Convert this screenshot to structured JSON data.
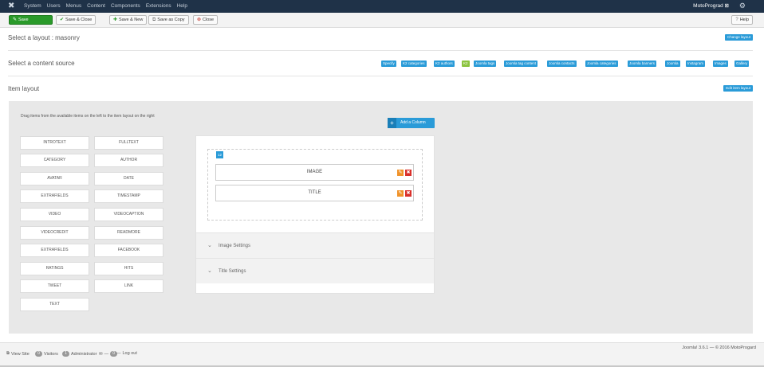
{
  "topbar": {
    "logo": "✖",
    "menu": [
      "System",
      "Users",
      "Menus",
      "Content",
      "Components",
      "Extensions",
      "Help"
    ],
    "user": "MotoPrograd ⊠",
    "gear": "⚙"
  },
  "toolbar": {
    "save": "Save",
    "save_close": "Save & Close",
    "save_new": "Save & New",
    "save_copy": "Save as Copy",
    "close": "Close",
    "help": "Help"
  },
  "sections": {
    "layout_label": "Select a layout : masonry",
    "layout_button": "Change layout",
    "source_label": "Select a content source",
    "sources": [
      "Specify",
      "K2 categories",
      "K2 authors",
      "K2",
      "Joomla tags",
      "Joomla tag content",
      "Joomla contacts",
      "Joomla categories",
      "Joomla banners",
      "Joomla",
      "Instagram",
      "Images",
      "Gallery"
    ],
    "item_layout_label": "Item layout",
    "item_layout_button": "Edit item layout"
  },
  "builder": {
    "hint": "Drag items from the available items on the left to the item layout on the right",
    "add_column": "Add a Column",
    "fields": [
      "INTROTEXT",
      "FULLTEXT",
      "CATEGORY",
      "AUTHOR",
      "AVATAR",
      "DATE",
      "EXTRAFIELDS",
      "TIMESTAMP",
      "VIDEO",
      "VIDEOCAPTION",
      "VIDEOCREDIT",
      "READMORE",
      "EXTRAFIELDS",
      "FACEBOOK",
      "RATINGS",
      "HITS",
      "TWEET",
      "LINK",
      "TEXT"
    ],
    "column_badge": "12",
    "items": [
      "IMAGE",
      "TITLE"
    ],
    "settings": [
      "Image Settings",
      "Title Settings"
    ]
  },
  "footer": {
    "view_site": "View Site",
    "visitors_count": "0",
    "visitors": "Visitors",
    "admins_count": "1",
    "admins": "Administrator",
    "messages_count": "0",
    "logout": "Log out",
    "credit": "Joomla! 3.6.1 — © 2016 MotoProgard"
  },
  "colors": {
    "accent": "#2a9bd8",
    "save": "#2a9a2a",
    "topbar": "#1f3248",
    "active_source": "#8cc43f"
  }
}
